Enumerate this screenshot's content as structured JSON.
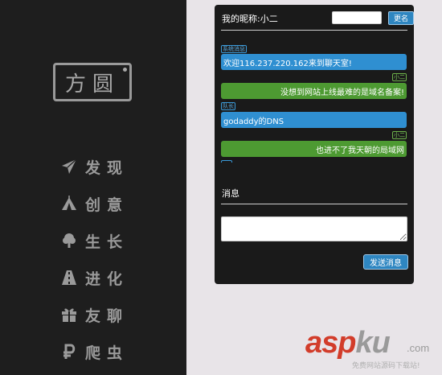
{
  "sidebar": {
    "logo_text": "方圆",
    "items": [
      {
        "label": "发现",
        "icon": "paper-plane-icon"
      },
      {
        "label": "创意",
        "icon": "tent-icon"
      },
      {
        "label": "生长",
        "icon": "tree-icon"
      },
      {
        "label": "进化",
        "icon": "road-icon"
      },
      {
        "label": "友聊",
        "icon": "gift-icon"
      },
      {
        "label": "爬虫",
        "icon": "ruble-icon"
      }
    ]
  },
  "chat": {
    "nickname_label": "我的昵称:小二",
    "nickname_value": "",
    "rename_label": "更名",
    "messages": [
      {
        "sender": "系统消息",
        "text": "欢迎116.237.220.162来到聊天室!",
        "side": "left"
      },
      {
        "sender": "小二",
        "text": "没想到网站上线最难的是域名备案!",
        "side": "right"
      },
      {
        "sender": "队长",
        "text": "godaddy的DNS",
        "side": "left"
      },
      {
        "sender": "小二",
        "text": "也进不了我天朝的局域网",
        "side": "right"
      }
    ],
    "message_heading": "消息",
    "message_value": "",
    "send_label": "发送消息"
  },
  "watermark": {
    "brand_red": "asp",
    "brand_gray": "ku",
    "domain": ".com",
    "tagline": "免费网站源码下载站!"
  },
  "colors": {
    "sidebar_bg": "#1e1e1e",
    "chat_bg": "#1a1a1a",
    "page_bg": "#e8e4e8",
    "bubble_blue": "#2f8fd1",
    "bubble_green": "#4d9a32",
    "button_blue": "#2e86c1"
  }
}
